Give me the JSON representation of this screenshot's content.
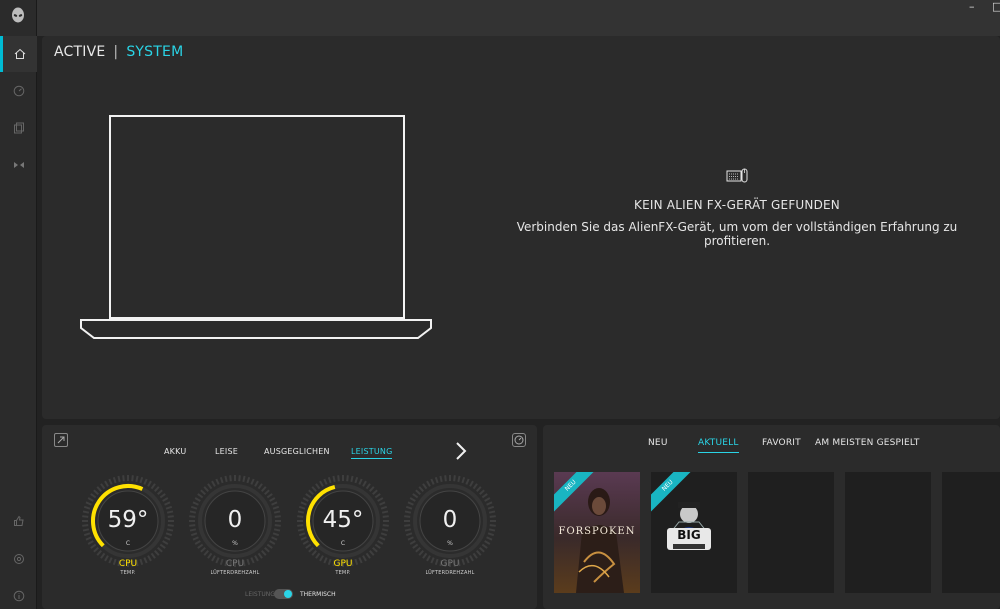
{
  "titlebar": {
    "controls": [
      "–",
      "□"
    ]
  },
  "rail": {
    "items": [
      {
        "icon": "home-icon",
        "active": true
      },
      {
        "icon": "gauge-icon",
        "active": false
      },
      {
        "icon": "library-icon",
        "active": false
      },
      {
        "icon": "fusion-icon",
        "active": false
      }
    ],
    "bottom": [
      {
        "icon": "thumbs-up-icon"
      },
      {
        "icon": "settings-icon"
      },
      {
        "icon": "info-icon"
      }
    ]
  },
  "breadcrumb": {
    "active": "ACTIVE",
    "separator": "|",
    "system": "SYSTEM"
  },
  "alienfx": {
    "title": "KEIN ALIEN FX-GERÄT GEFUNDEN",
    "message": "Verbinden Sie das AlienFX-Gerät, um vom der vollständigen Erfahrung zu profitieren."
  },
  "performance": {
    "modes": [
      {
        "label": "AKKU",
        "active": false
      },
      {
        "label": "LEISE",
        "active": false
      },
      {
        "label": "AUSGEGLICHEN",
        "active": false
      },
      {
        "label": "LEISTUNG",
        "active": true
      }
    ],
    "gauges": [
      {
        "value": "59°",
        "unit": "C",
        "name": "CPU",
        "sub": "TEMP.",
        "hot": true,
        "fill": 0.59
      },
      {
        "value": "0",
        "unit": "%",
        "name": "CPU",
        "sub": "LÜFTERDREHZAHL",
        "hot": false,
        "fill": 0
      },
      {
        "value": "45°",
        "unit": "C",
        "name": "GPU",
        "sub": "TEMP.",
        "hot": true,
        "fill": 0.45
      },
      {
        "value": "0",
        "unit": "%",
        "name": "GPU",
        "sub": "LÜFTERDREHZAHL",
        "hot": false,
        "fill": 0
      }
    ],
    "toggle": {
      "left": "LEISTUNG",
      "right": "THERMISCH"
    }
  },
  "games": {
    "tabs": [
      {
        "label": "NEU",
        "active": false
      },
      {
        "label": "AKTUELL",
        "active": true
      },
      {
        "label": "FAVORIT",
        "active": false
      },
      {
        "label": "AM MEISTEN GESPIELT",
        "active": false
      }
    ],
    "tiles": [
      {
        "badge": "NEU",
        "title": "FORSPOKEN",
        "art": "forspoken"
      },
      {
        "badge": "NEU",
        "title": "BIG",
        "art": "big"
      },
      {
        "badge": "",
        "title": "",
        "art": "empty"
      },
      {
        "badge": "",
        "title": "",
        "art": "empty"
      },
      {
        "badge": "",
        "title": "",
        "art": "empty"
      }
    ]
  }
}
